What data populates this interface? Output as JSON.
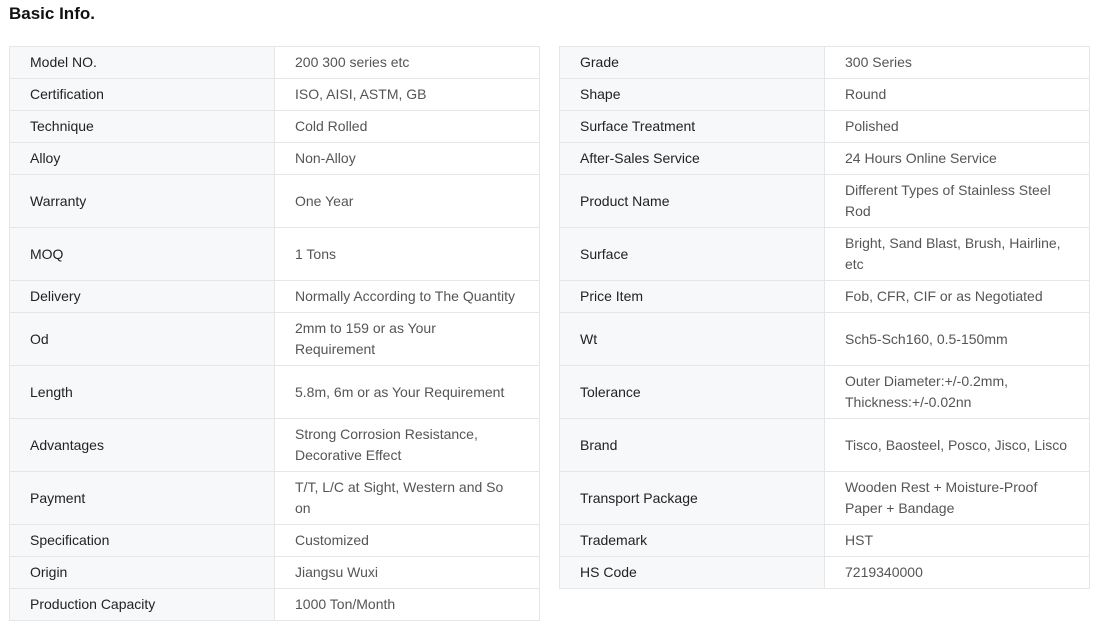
{
  "title": "Basic Info.",
  "left": [
    {
      "key": "Model NO.",
      "value": "200 300 series etc"
    },
    {
      "key": "Certification",
      "value": "ISO, AISI, ASTM, GB"
    },
    {
      "key": "Technique",
      "value": "Cold Rolled"
    },
    {
      "key": "Alloy",
      "value": "Non-Alloy"
    },
    {
      "key": "Warranty",
      "value": "One Year"
    },
    {
      "key": "MOQ",
      "value": "1 Tons"
    },
    {
      "key": "Delivery",
      "value": "Normally According to The Quantity"
    },
    {
      "key": "Od",
      "value": "2mm to 159 or as Your Requirement"
    },
    {
      "key": "Length",
      "value": "5.8m, 6m or as Your Requirement"
    },
    {
      "key": "Advantages",
      "value": "Strong Corrosion Resistance, Decorative Effect"
    },
    {
      "key": "Payment",
      "value": "T/T, L/C at Sight, Western and So on"
    },
    {
      "key": "Specification",
      "value": "Customized"
    },
    {
      "key": "Origin",
      "value": "Jiangsu Wuxi"
    },
    {
      "key": "Production Capacity",
      "value": "1000 Ton/Month"
    }
  ],
  "right": [
    {
      "key": "Grade",
      "value": "300 Series"
    },
    {
      "key": "Shape",
      "value": "Round"
    },
    {
      "key": "Surface Treatment",
      "value": "Polished"
    },
    {
      "key": "After-Sales Service",
      "value": "24 Hours Online Service"
    },
    {
      "key": "Product Name",
      "value": "Different Types of Stainless Steel Rod"
    },
    {
      "key": "Surface",
      "value": "Bright, Sand Blast, Brush, Hairline, etc"
    },
    {
      "key": "Price Item",
      "value": "Fob, CFR, CIF or as Negotiated"
    },
    {
      "key": "Wt",
      "value": "Sch5-Sch160, 0.5-150mm"
    },
    {
      "key": "Tolerance",
      "value": "Outer Diameter:+/-0.2mm, Thickness:+/-0.02nn"
    },
    {
      "key": "Brand",
      "value": "Tisco, Baosteel, Posco, Jisco, Lisco"
    },
    {
      "key": "Transport Package",
      "value": "Wooden Rest + Moisture-Proof Paper + Bandage"
    },
    {
      "key": "Trademark",
      "value": "HST"
    },
    {
      "key": "HS Code",
      "value": "7219340000"
    }
  ]
}
